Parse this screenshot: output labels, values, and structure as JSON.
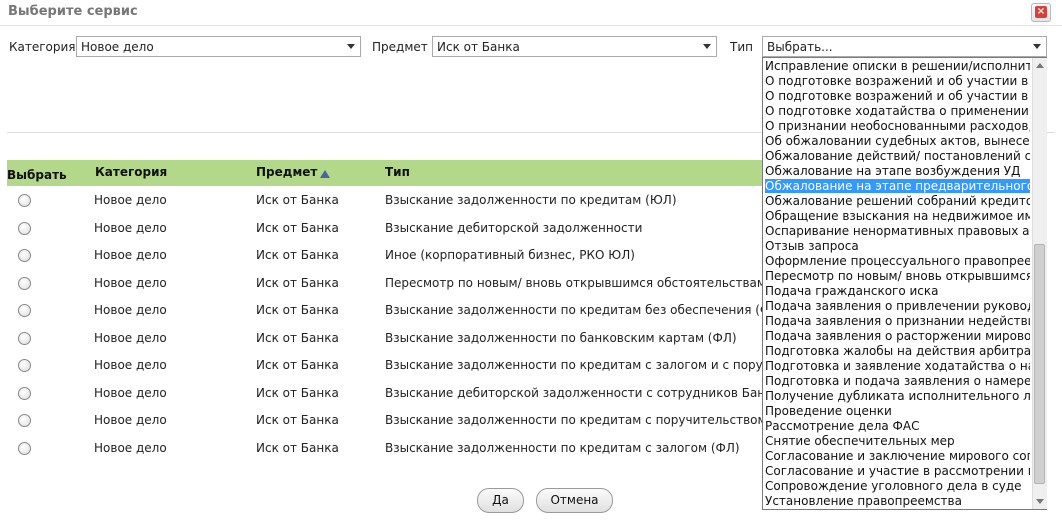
{
  "dialog": {
    "title": "Выберите сервис",
    "close_label": "×"
  },
  "filters": {
    "category_label": "Категория",
    "category_value": "Новое дело",
    "subject_label": "Предмет",
    "subject_value": "Иск от Банка",
    "type_label": "Тип",
    "type_value": "Выбрать..."
  },
  "grid": {
    "headers": {
      "select": "Выбрать",
      "category": "Категория",
      "subject": "Предмет",
      "type": "Тип"
    },
    "sort_column": "Предмет",
    "rows": [
      {
        "category": "Новое дело",
        "subject": "Иск от Банка",
        "type": "Взыскание задолженности по кредитам (ЮЛ)"
      },
      {
        "category": "Новое дело",
        "subject": "Иск от Банка",
        "type": "Взыскание дебиторской задолженности"
      },
      {
        "category": "Новое дело",
        "subject": "Иск от Банка",
        "type": "Иное (корпоративный бизнес, РКО ЮЛ)"
      },
      {
        "category": "Новое дело",
        "subject": "Иск от Банка",
        "type": "Пересмотр по новым/ вновь открывшимся обстоятельствам"
      },
      {
        "category": "Новое дело",
        "subject": "Иск от Банка",
        "type": "Взыскание задолженности по кредитам без обеспечения (ФЛ)"
      },
      {
        "category": "Новое дело",
        "subject": "Иск от Банка",
        "type": "Взыскание задолженности по банковским картам (ФЛ)"
      },
      {
        "category": "Новое дело",
        "subject": "Иск от Банка",
        "type": "Взыскание задолженности по кредитам с залогом и с поручительством (ФЛ)"
      },
      {
        "category": "Новое дело",
        "subject": "Иск от Банка",
        "type": "Взыскание дебиторской задолженности с сотрудников Банка"
      },
      {
        "category": "Новое дело",
        "subject": "Иск от Банка",
        "type": "Взыскание задолженности по кредитам с поручительством (ФЛ)"
      },
      {
        "category": "Новое дело",
        "subject": "Иск от Банка",
        "type": "Взыскание задолженности по кредитам с залогом (ФЛ)"
      }
    ]
  },
  "type_dropdown": {
    "selected_index": 8,
    "options": [
      "Исправление описки в решении/исполнительном листе",
      "О подготовке возражений и об участии в качестве третьего лица",
      "О подготовке возражений и об участии в судебном заседании",
      "О подготовке ходатайства о применении обеспечительных мер",
      "О признании необоснованными расходов, совершенных",
      "Об обжаловании судебных актов, вынесенных",
      "Обжалование действий/ постановлений судебного пристава",
      "Обжалование на этапе возбуждения УД",
      "Обжалование на этапе предварительного расследования",
      "Обжалование решений собраний кредиторов,",
      "Обращение взыскания на недвижимое имущество",
      "Оспаривание ненормативных правовых актов",
      "Отзыв запроса",
      "Оформление процессуального правопреемства",
      "Пересмотр по новым/ вновь открывшимся обстоятельствам",
      "Подача гражданского иска",
      "Подача заявления о привлечении руководителя",
      "Подача заявления о признании недействительными",
      "Подача заявления о расторжении мирового соглашения",
      "Подготовка жалобы на действия арбитражного управляющего",
      "Подготовка и заявление ходатайства о назначении",
      "Подготовка и подача заявления о намерении",
      "Получение дубликата исполнительного листа",
      "Проведение оценки",
      "Рассмотрение дела ФАС",
      "Снятие обеспечительных мер",
      "Согласование и заключение мирового соглашения",
      "Согласование и участие в рассмотрении поряд",
      "Сопровождение уголовного дела в суде",
      "Установление правопреемства"
    ]
  },
  "buttons": {
    "ok": "Да",
    "cancel": "Отмена"
  },
  "colors": {
    "header_bg": "#b4d88a",
    "selected_option_bg": "#3399ff",
    "close_icon": "#d8413a"
  }
}
